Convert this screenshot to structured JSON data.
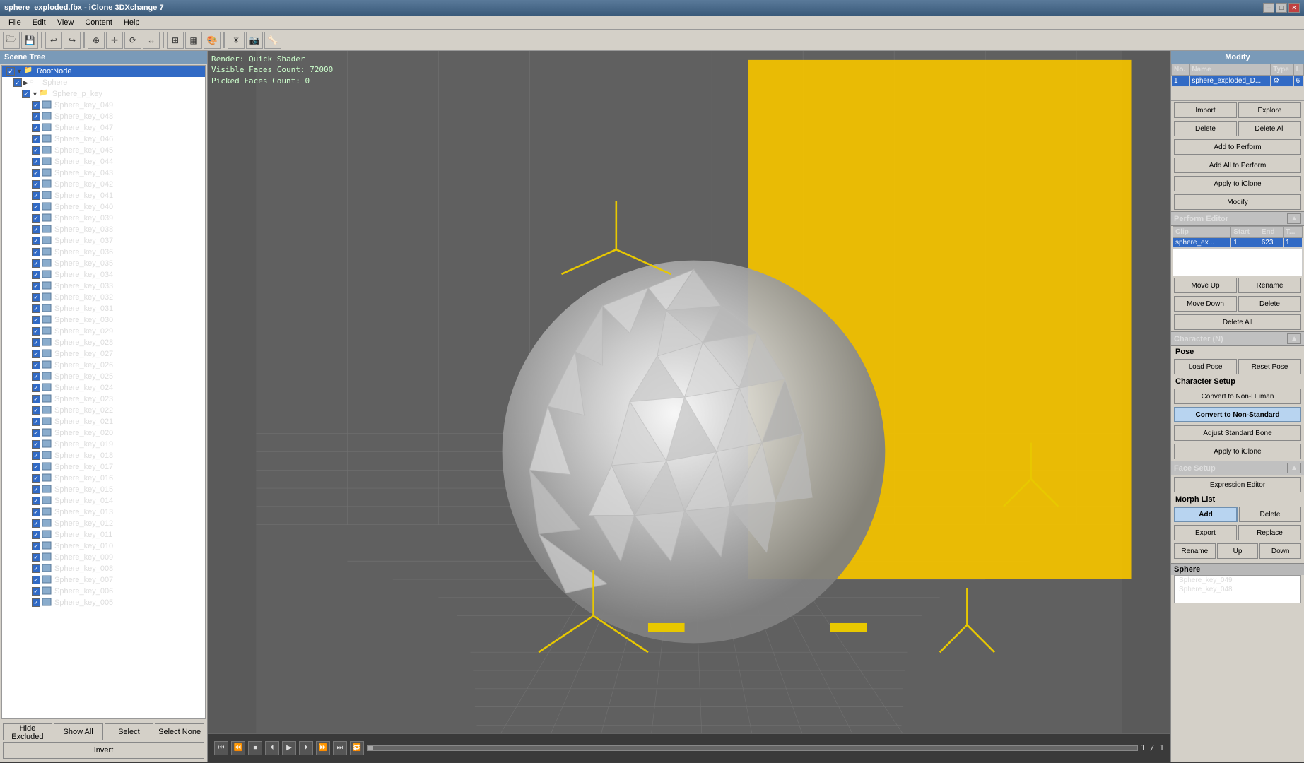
{
  "titlebar": {
    "title": "sphere_exploded.fbx - iClone 3DXchange 7",
    "min_btn": "─",
    "max_btn": "□",
    "close_btn": "✕"
  },
  "menubar": {
    "items": [
      "File",
      "Edit",
      "View",
      "Content",
      "Help"
    ]
  },
  "toolbar": {
    "buttons": [
      "🗁",
      "💾",
      "📋",
      "↩",
      "↪",
      "🔲",
      "⊕",
      "⊖",
      "↔",
      "↕",
      "⟳",
      "⟲",
      "⊞",
      "✂"
    ]
  },
  "scene_tree": {
    "header": "Scene Tree",
    "nodes": [
      {
        "id": "root",
        "label": "RootNode",
        "level": 0,
        "selected": true,
        "expanded": true,
        "has_checkbox": true,
        "checked": true
      },
      {
        "id": "sphere",
        "label": "Sphere",
        "level": 1,
        "selected": false,
        "expanded": true,
        "has_checkbox": true,
        "checked": true
      },
      {
        "id": "sphere_p_key",
        "label": "Sphere_p_key",
        "level": 2,
        "selected": false,
        "expanded": true,
        "has_checkbox": true,
        "checked": true
      },
      {
        "id": "key049",
        "label": "Sphere_key_049",
        "level": 3,
        "selected": false,
        "has_checkbox": true,
        "checked": true
      },
      {
        "id": "key048",
        "label": "Sphere_key_048",
        "level": 3,
        "selected": false,
        "has_checkbox": true,
        "checked": true
      },
      {
        "id": "key047",
        "label": "Sphere_key_047",
        "level": 3,
        "selected": false,
        "has_checkbox": true,
        "checked": true
      },
      {
        "id": "key046",
        "label": "Sphere_key_046",
        "level": 3,
        "selected": false,
        "has_checkbox": true,
        "checked": true
      },
      {
        "id": "key045",
        "label": "Sphere_key_045",
        "level": 3,
        "selected": false,
        "has_checkbox": true,
        "checked": true
      },
      {
        "id": "key044",
        "label": "Sphere_key_044",
        "level": 3,
        "selected": false,
        "has_checkbox": true,
        "checked": true
      },
      {
        "id": "key043",
        "label": "Sphere_key_043",
        "level": 3,
        "selected": false,
        "has_checkbox": true,
        "checked": true
      },
      {
        "id": "key042",
        "label": "Sphere_key_042",
        "level": 3,
        "selected": false,
        "has_checkbox": true,
        "checked": true
      },
      {
        "id": "key041",
        "label": "Sphere_key_041",
        "level": 3,
        "selected": false,
        "has_checkbox": true,
        "checked": true
      },
      {
        "id": "key040",
        "label": "Sphere_key_040",
        "level": 3,
        "selected": false,
        "has_checkbox": true,
        "checked": true
      },
      {
        "id": "key039",
        "label": "Sphere_key_039",
        "level": 3,
        "selected": false,
        "has_checkbox": true,
        "checked": true
      },
      {
        "id": "key038",
        "label": "Sphere_key_038",
        "level": 3,
        "selected": false,
        "has_checkbox": true,
        "checked": true
      },
      {
        "id": "key037",
        "label": "Sphere_key_037",
        "level": 3,
        "selected": false,
        "has_checkbox": true,
        "checked": true
      },
      {
        "id": "key036",
        "label": "Sphere_key_036",
        "level": 3,
        "selected": false,
        "has_checkbox": true,
        "checked": true
      },
      {
        "id": "key035",
        "label": "Sphere_key_035",
        "level": 3,
        "selected": false,
        "has_checkbox": true,
        "checked": true
      },
      {
        "id": "key034",
        "label": "Sphere_key_034",
        "level": 3,
        "selected": false,
        "has_checkbox": true,
        "checked": true
      },
      {
        "id": "key033",
        "label": "Sphere_key_033",
        "level": 3,
        "selected": false,
        "has_checkbox": true,
        "checked": true
      },
      {
        "id": "key032",
        "label": "Sphere_key_032",
        "level": 3,
        "selected": false,
        "has_checkbox": true,
        "checked": true
      },
      {
        "id": "key031",
        "label": "Sphere_key_031",
        "level": 3,
        "selected": false,
        "has_checkbox": true,
        "checked": true
      },
      {
        "id": "key030",
        "label": "Sphere_key_030",
        "level": 3,
        "selected": false,
        "has_checkbox": true,
        "checked": true
      },
      {
        "id": "key029",
        "label": "Sphere_key_029",
        "level": 3,
        "selected": false,
        "has_checkbox": true,
        "checked": true
      },
      {
        "id": "key028",
        "label": "Sphere_key_028",
        "level": 3,
        "selected": false,
        "has_checkbox": true,
        "checked": true
      },
      {
        "id": "key027",
        "label": "Sphere_key_027",
        "level": 3,
        "selected": false,
        "has_checkbox": true,
        "checked": true
      },
      {
        "id": "key026",
        "label": "Sphere_key_026",
        "level": 3,
        "selected": false,
        "has_checkbox": true,
        "checked": true
      },
      {
        "id": "key025",
        "label": "Sphere_key_025",
        "level": 3,
        "selected": false,
        "has_checkbox": true,
        "checked": true
      },
      {
        "id": "key024",
        "label": "Sphere_key_024",
        "level": 3,
        "selected": false,
        "has_checkbox": true,
        "checked": true
      },
      {
        "id": "key023",
        "label": "Sphere_key_023",
        "level": 3,
        "selected": false,
        "has_checkbox": true,
        "checked": true
      },
      {
        "id": "key022",
        "label": "Sphere_key_022",
        "level": 3,
        "selected": false,
        "has_checkbox": true,
        "checked": true
      },
      {
        "id": "key021",
        "label": "Sphere_key_021",
        "level": 3,
        "selected": false,
        "has_checkbox": true,
        "checked": true
      },
      {
        "id": "key020",
        "label": "Sphere_key_020",
        "level": 3,
        "selected": false,
        "has_checkbox": true,
        "checked": true
      },
      {
        "id": "key019",
        "label": "Sphere_key_019",
        "level": 3,
        "selected": false,
        "has_checkbox": true,
        "checked": true
      },
      {
        "id": "key018",
        "label": "Sphere_key_018",
        "level": 3,
        "selected": false,
        "has_checkbox": true,
        "checked": true
      },
      {
        "id": "key017",
        "label": "Sphere_key_017",
        "level": 3,
        "selected": false,
        "has_checkbox": true,
        "checked": true
      },
      {
        "id": "key016",
        "label": "Sphere_key_016",
        "level": 3,
        "selected": false,
        "has_checkbox": true,
        "checked": true
      },
      {
        "id": "key015",
        "label": "Sphere_key_015",
        "level": 3,
        "selected": false,
        "has_checkbox": true,
        "checked": true
      },
      {
        "id": "key014",
        "label": "Sphere_key_014",
        "level": 3,
        "selected": false,
        "has_checkbox": true,
        "checked": true
      },
      {
        "id": "key013",
        "label": "Sphere_key_013",
        "level": 3,
        "selected": false,
        "has_checkbox": true,
        "checked": true
      },
      {
        "id": "key012",
        "label": "Sphere_key_012",
        "level": 3,
        "selected": false,
        "has_checkbox": true,
        "checked": true
      },
      {
        "id": "key011",
        "label": "Sphere_key_011",
        "level": 3,
        "selected": false,
        "has_checkbox": true,
        "checked": true
      },
      {
        "id": "key010",
        "label": "Sphere_key_010",
        "level": 3,
        "selected": false,
        "has_checkbox": true,
        "checked": true
      },
      {
        "id": "key009",
        "label": "Sphere_key_009",
        "level": 3,
        "selected": false,
        "has_checkbox": true,
        "checked": true
      },
      {
        "id": "key008",
        "label": "Sphere_key_008",
        "level": 3,
        "selected": false,
        "has_checkbox": true,
        "checked": true
      },
      {
        "id": "key007",
        "label": "Sphere_key_007",
        "level": 3,
        "selected": false,
        "has_checkbox": true,
        "checked": true
      },
      {
        "id": "key006",
        "label": "Sphere_key_006",
        "level": 3,
        "selected": false,
        "has_checkbox": true,
        "checked": true
      },
      {
        "id": "key005",
        "label": "Sphere_key_005",
        "level": 3,
        "selected": false,
        "has_checkbox": true,
        "checked": true
      }
    ],
    "buttons": {
      "hide_excluded": "Hide Excluded",
      "show_all": "Show All",
      "select_all": "Select",
      "select_none": "Select None",
      "invert": "Invert"
    }
  },
  "viewport": {
    "render_mode": "Render: Quick Shader",
    "visible_faces": "Visible Faces Count: 72000",
    "picked_faces": "Picked Faces Count: 0"
  },
  "timeline": {
    "current_frame": "1 / 1",
    "buttons": [
      "⏮",
      "⏪",
      "⏹",
      "⏴",
      "▶",
      "⏵",
      "⏩",
      "⏭",
      "🔁"
    ]
  },
  "right_panel": {
    "modify_label": "Modify",
    "modify_table": {
      "headers": [
        "No.",
        "Name",
        "Type",
        "L"
      ],
      "rows": [
        {
          "no": "1",
          "name": "sphere_exploded_D...",
          "type": "⚙",
          "l": "6",
          "selected": true
        }
      ]
    },
    "import_btn": "Import",
    "explore_btn": "Explore",
    "delete_btn": "Delete",
    "delete_all_btn": "Delete All",
    "add_to_perform_btn": "Add to Perform",
    "add_all_to_perform_btn": "Add All to Perform",
    "apply_to_iclone_btn": "Apply to iClone",
    "modify_btn": "Modify",
    "perform_editor_label": "Perform Editor",
    "perform_table": {
      "headers": [
        "Clip",
        "Start",
        "End",
        "T..."
      ],
      "rows": [
        {
          "clip": "sphere_ex...",
          "start": "1",
          "end": "623",
          "t": "1",
          "selected": true
        }
      ]
    },
    "move_up_btn": "Move Up",
    "rename_btn": "Rename",
    "move_down_btn": "Move Down",
    "delete_pe_btn": "Delete",
    "delete_all_pe_btn": "Delete All",
    "character_n_label": "Character (N)",
    "pose_label": "Pose",
    "load_pose_btn": "Load Pose",
    "reset_pose_btn": "Reset Pose",
    "character_setup_label": "Character Setup",
    "convert_non_human_btn": "Convert to Non-Human",
    "convert_non_standard_btn": "Convert to Non-Standard",
    "adjust_standard_bone_btn": "Adjust Standard Bone",
    "apply_iclone_cs_btn": "Apply to iClone",
    "face_setup_label": "Face Setup",
    "expression_editor_btn": "Expression Editor",
    "morph_list_label": "Morph List",
    "add_morph_btn": "Add",
    "delete_morph_btn": "Delete",
    "export_morph_btn": "Export",
    "replace_morph_btn": "Replace",
    "rename_morph_btn": "Rename",
    "up_morph_btn": "Up",
    "down_morph_btn": "Down",
    "bottom_section_title": "Sphere",
    "bottom_items": [
      "Sphere_key_049",
      "Sphere_key_048"
    ]
  }
}
